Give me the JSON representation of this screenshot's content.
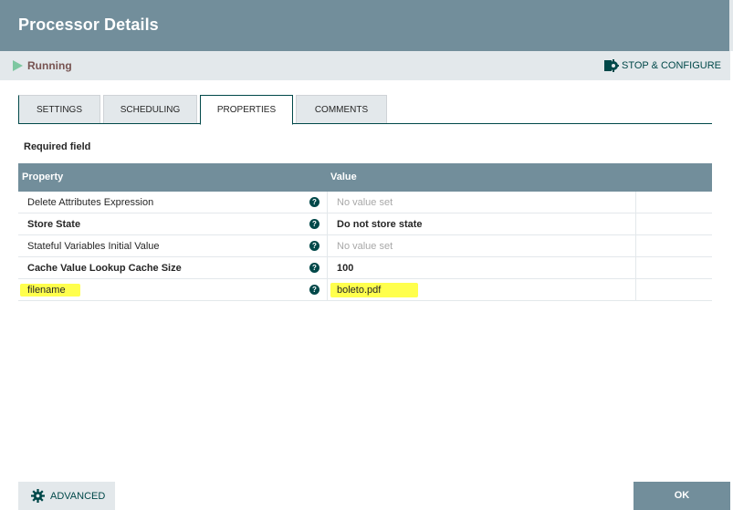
{
  "dialog": {
    "title": "Processor Details"
  },
  "status": {
    "text": "Running",
    "icon": "play-icon",
    "color": "#7dc7a0"
  },
  "toolbar": {
    "stop_configure_label": "STOP & CONFIGURE",
    "icon": "gear-icon"
  },
  "tabs": [
    {
      "label": "SETTINGS",
      "active": false
    },
    {
      "label": "SCHEDULING",
      "active": false
    },
    {
      "label": "PROPERTIES",
      "active": true
    },
    {
      "label": "COMMENTS",
      "active": false
    }
  ],
  "required_field": "Required field",
  "table": {
    "headers": {
      "property": "Property",
      "value": "Value"
    },
    "rows": [
      {
        "property": "Delete Attributes Expression",
        "value": "No value set",
        "required": false,
        "unset": true
      },
      {
        "property": "Store State",
        "value": "Do not store state",
        "required": true,
        "unset": false
      },
      {
        "property": "Stateful Variables Initial Value",
        "value": "No value set",
        "required": false,
        "unset": true
      },
      {
        "property": "Cache Value Lookup Cache Size",
        "value": "100",
        "required": true,
        "unset": false
      },
      {
        "property": "filename",
        "value": "boleto.pdf",
        "required": false,
        "unset": false,
        "highlighted": true
      }
    ],
    "help_glyph": "?"
  },
  "footer": {
    "advanced_label": "ADVANCED",
    "ok_label": "OK"
  },
  "colors": {
    "header": "#728e9b",
    "accent": "#004849",
    "highlight": "#ffff4d"
  }
}
